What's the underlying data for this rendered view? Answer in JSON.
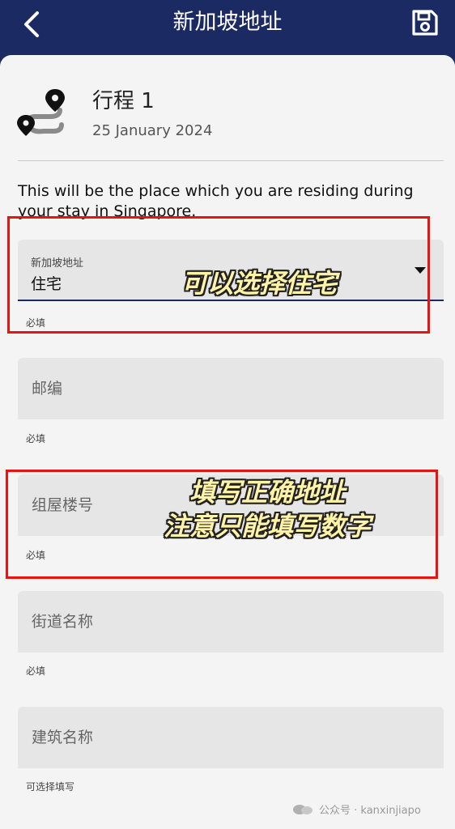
{
  "header": {
    "title": "新加坡地址",
    "back_icon": "chevron-left-icon",
    "save_icon": "save-icon"
  },
  "trip": {
    "name": "行程 1",
    "date": "25 January 2024",
    "icon": "route-pins-icon"
  },
  "intro_text": "This will be the place which you are residing during your stay in Singapore.",
  "fields": [
    {
      "label": "新加坡地址",
      "value": "住宅",
      "hint": "必填",
      "type": "select"
    },
    {
      "placeholder": "邮编",
      "hint": "必填"
    },
    {
      "placeholder": "组屋楼号",
      "hint": "必填"
    },
    {
      "placeholder": "街道名称",
      "hint": "必填"
    },
    {
      "placeholder": "建筑名称",
      "hint": "可选择填写"
    }
  ],
  "annotations": {
    "first": "可以选择住宅",
    "second_line1": "填写正确地址",
    "second_line2": "注意只能填写数字"
  },
  "watermark": {
    "text": "公众号 · kanxinjiapo"
  },
  "colors": {
    "header_bg": "#1b2a63",
    "card_bg": "#f4f4f4",
    "field_bg": "#e6e6e6",
    "annotation_box": "#e81414",
    "annotation_text": "#fff3a8"
  }
}
